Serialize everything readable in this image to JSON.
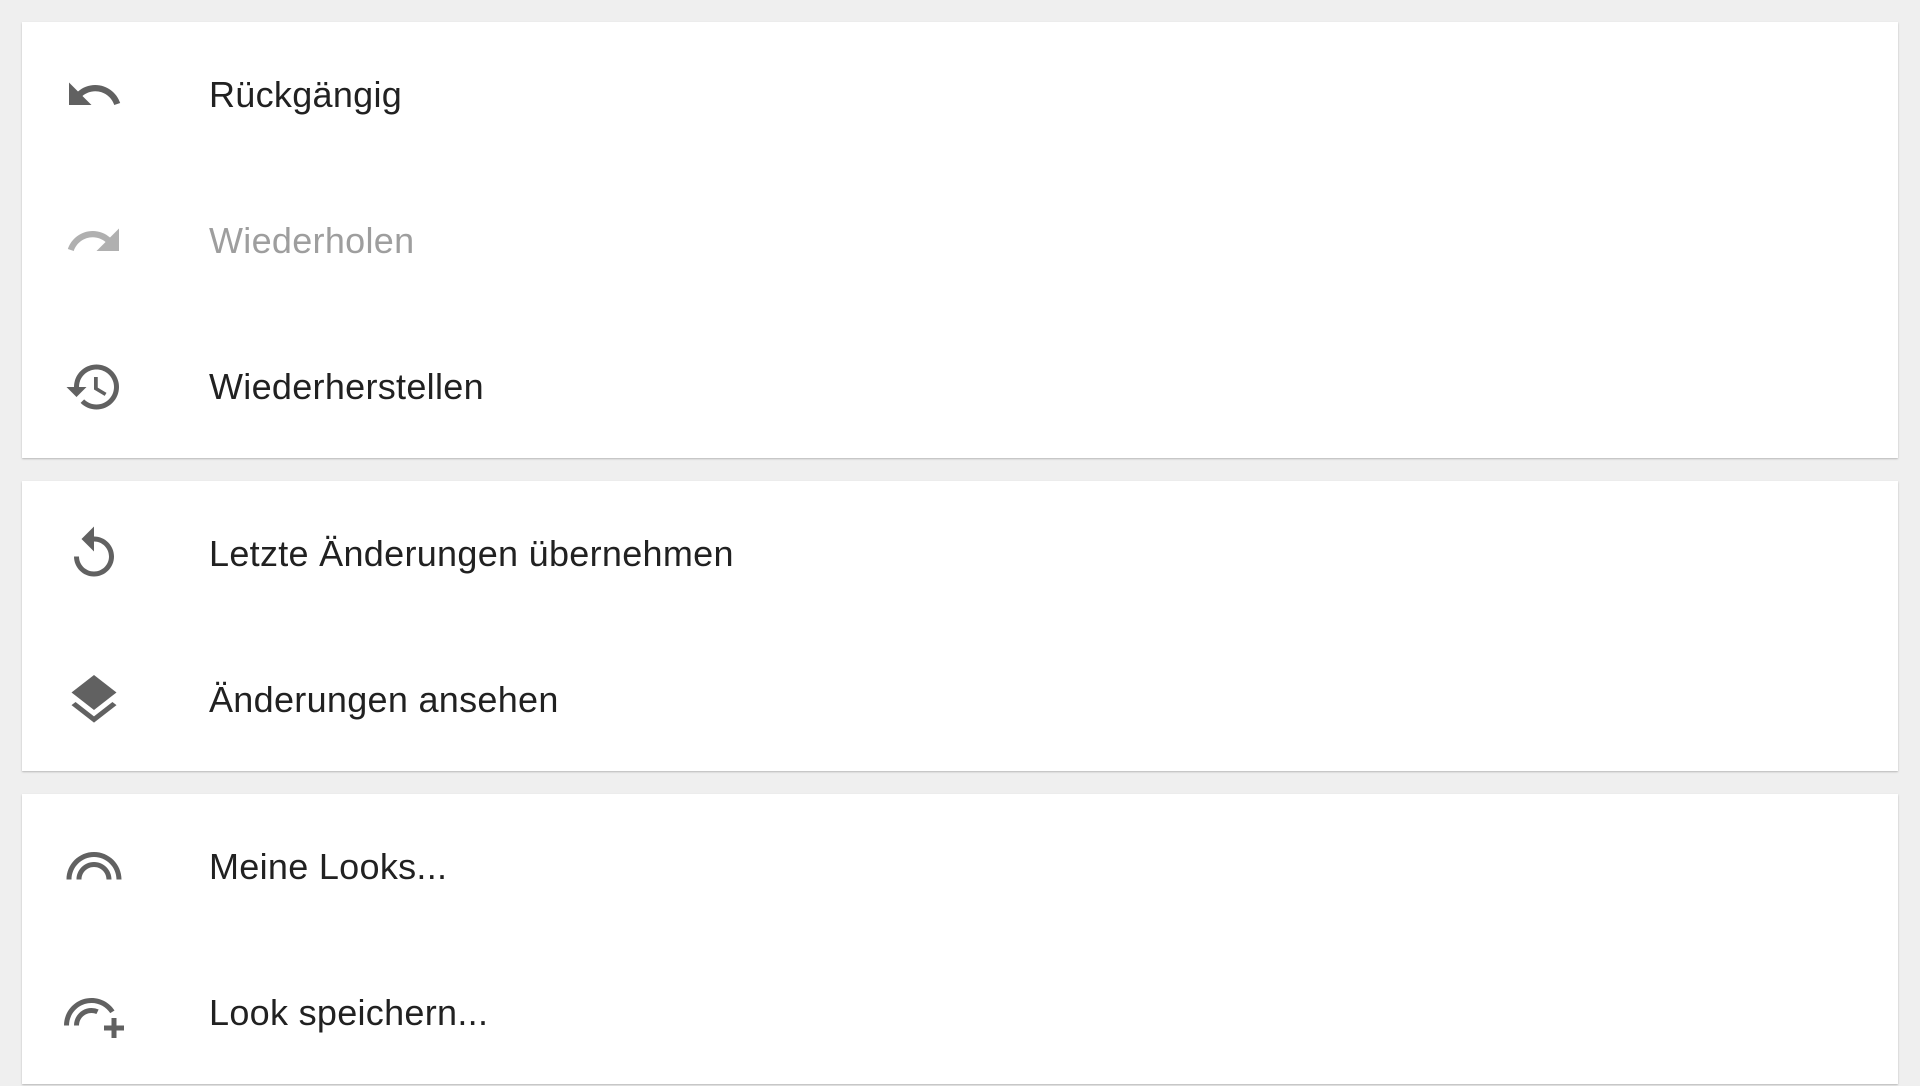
{
  "colors": {
    "background": "#efefef",
    "card": "#ffffff",
    "text": "#212121",
    "text_disabled": "#9e9e9e",
    "icon": "#616161",
    "icon_disabled": "#b0b0b0"
  },
  "groups": [
    {
      "items": [
        {
          "label": "Rückgängig",
          "icon": "undo-icon",
          "enabled": true
        },
        {
          "label": "Wiederholen",
          "icon": "redo-icon",
          "enabled": false
        },
        {
          "label": "Wiederherstellen",
          "icon": "history-icon",
          "enabled": true
        }
      ]
    },
    {
      "items": [
        {
          "label": "Letzte Änderungen übernehmen",
          "icon": "rotate-left-icon",
          "enabled": true
        },
        {
          "label": "Änderungen ansehen",
          "icon": "layers-icon",
          "enabled": true
        }
      ]
    },
    {
      "items": [
        {
          "label": "Meine Looks...",
          "icon": "looks-icon",
          "enabled": true
        },
        {
          "label": "Look speichern...",
          "icon": "looks-add-icon",
          "enabled": true
        }
      ]
    }
  ]
}
